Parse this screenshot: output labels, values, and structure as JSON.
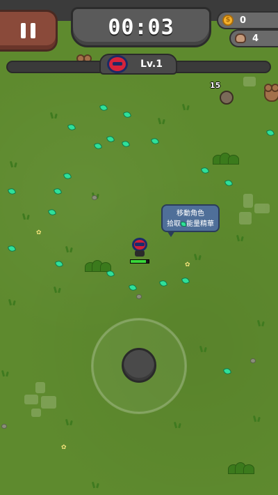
{
  "hud": {
    "timer": "00:03",
    "coins": "0",
    "kills": "4",
    "level": "Lv.1",
    "xp_progress": 0.0
  },
  "enemies": {
    "damage_number": "15"
  },
  "tooltip": {
    "line1": "移動角色",
    "line2a": "拾取",
    "line2b": "能量精華"
  },
  "player": {
    "hp_fraction": 0.85
  },
  "colors": {
    "grass": "#5e8a2e",
    "gem": "#2fe09a",
    "pause_button": "#8a4a3a",
    "timer_panel": "#5a5a5a",
    "tooltip_bg": "#4f6f99"
  },
  "icons": [
    "pause-icon",
    "coin-icon",
    "skull-icon",
    "player-avatar-icon",
    "gem-icon",
    "joystick-icon"
  ]
}
